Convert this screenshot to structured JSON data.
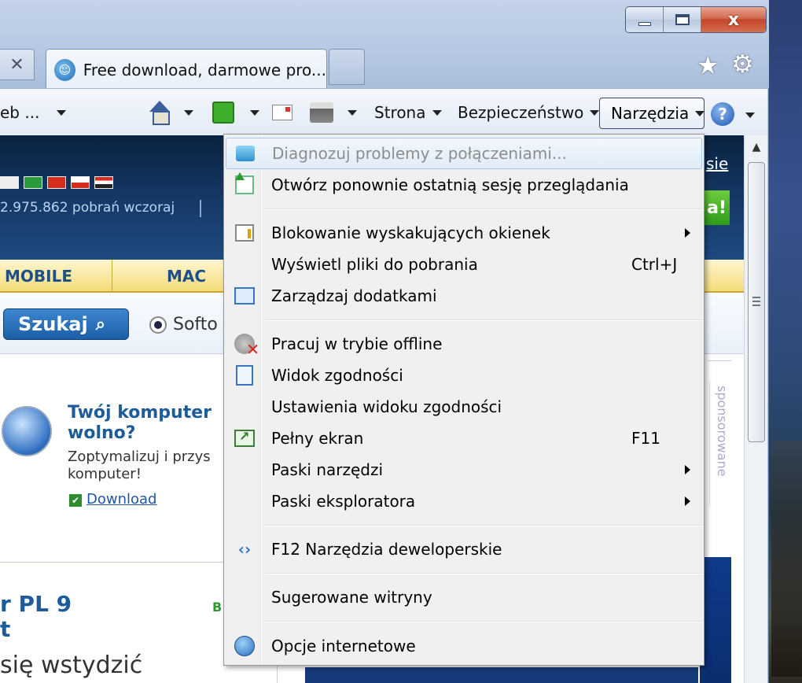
{
  "window": {
    "tab_title": "Free download, darmowe pro...",
    "close_glyph": "x"
  },
  "commandbar": {
    "left_fragment": "eb ...",
    "strona": "Strona",
    "bezpieczenstwo": "Bezpieczeństwo",
    "narzedzia": "Narzędzia",
    "help": "?"
  },
  "page": {
    "stats": "2.975.862 pobrań wczoraj",
    "link_partial": "sie",
    "green_button_text": "a!",
    "nav_tabs": [
      "MOBILE",
      "MAC"
    ],
    "search_button": "Szukaj",
    "search_option": "Softo",
    "promo_title": "Twój komputer wolno?",
    "promo_text": "Zoptymalizuj i przys komputer!",
    "download_link": "Download",
    "big_title": "r PL 9\nt",
    "big_subtitle": "się wstydzić",
    "green_label": "B",
    "sponsor": "sponsorowane"
  },
  "menu": {
    "items": [
      {
        "label": "Diagnozuj problemy z połączeniami...",
        "icon": "diagnose-icon",
        "disabled": true
      },
      {
        "label": "Otwórz ponownie ostatnią sesję przeglądania",
        "icon": "reopen-session-icon"
      },
      {
        "label": "Blokowanie wyskakujących okienek",
        "icon": "popup-blocker-icon",
        "submenu": true
      },
      {
        "label": "Wyświetl pliki do pobrania",
        "shortcut": "Ctrl+J"
      },
      {
        "label": "Zarządzaj dodatkami",
        "icon": "addons-icon"
      },
      {
        "label": "Pracuj w trybie offline",
        "icon": "offline-icon"
      },
      {
        "label": "Widok zgodności",
        "icon": "compatibility-icon"
      },
      {
        "label": "Ustawienia widoku zgodności"
      },
      {
        "label": "Pełny ekran",
        "icon": "fullscreen-icon",
        "shortcut": "F11"
      },
      {
        "label": "Paski narzędzi",
        "submenu": true
      },
      {
        "label": "Paski eksploratora",
        "submenu": true
      },
      {
        "label": "F12 Narzędzia deweloperskie",
        "icon": "developer-tools-icon"
      },
      {
        "label": "Sugerowane witryny"
      },
      {
        "label": "Opcje internetowe",
        "icon": "internet-options-icon"
      }
    ]
  }
}
